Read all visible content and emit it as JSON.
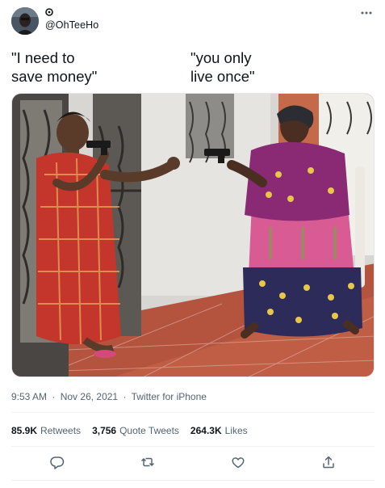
{
  "author": {
    "handle": "@OhTeeHo",
    "avatar_icon": "avatar",
    "verified_icon": "badge-icon"
  },
  "caption": {
    "left": "\"I need to\nsave money\"",
    "right": "\"you only\n live once\""
  },
  "meta": {
    "time": "9:53 AM",
    "date": "Nov 26, 2021",
    "source": "Twitter for iPhone",
    "separator": "·"
  },
  "stats": {
    "retweets_count": "85.9K",
    "retweets_label": "Retweets",
    "quotes_count": "3,756",
    "quotes_label": "Quote Tweets",
    "likes_count": "264.3K",
    "likes_label": "Likes"
  },
  "actions": [
    "reply-icon",
    "retweet-icon",
    "like-icon",
    "share-icon"
  ],
  "colors": {
    "text": "#0f1419",
    "secondary": "#536471",
    "divider": "#eff3f4"
  }
}
